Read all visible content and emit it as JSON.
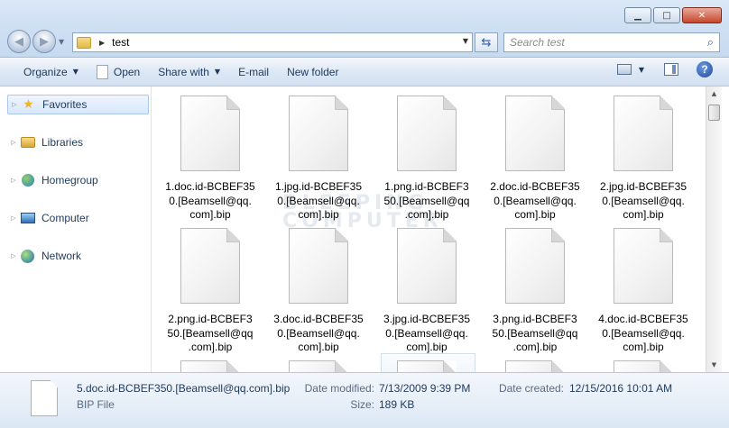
{
  "address": {
    "path": "test"
  },
  "search": {
    "placeholder": "Search test"
  },
  "toolbar": {
    "organize": "Organize",
    "open": "Open",
    "share_with": "Share with",
    "email": "E-mail",
    "new_folder": "New folder"
  },
  "sidebar": {
    "items": [
      {
        "label": "Favorites"
      },
      {
        "label": "Libraries"
      },
      {
        "label": "Homegroup"
      },
      {
        "label": "Computer"
      },
      {
        "label": "Network"
      }
    ]
  },
  "files": [
    {
      "name": "1.doc.id-BCBEF350.[Beamsell@qq.com].bip",
      "lines": [
        "1.doc.id-BCBEF35",
        "0.[Beamsell@qq.",
        "com].bip"
      ]
    },
    {
      "name": "1.jpg.id-BCBEF350.[Beamsell@qq.com].bip",
      "lines": [
        "1.jpg.id-BCBEF35",
        "0.[Beamsell@qq.",
        "com].bip"
      ]
    },
    {
      "name": "1.png.id-BCBEF350.[Beamsell@qq.com].bip",
      "lines": [
        "1.png.id-BCBEF3",
        "50.[Beamsell@qq",
        ".com].bip"
      ]
    },
    {
      "name": "2.doc.id-BCBEF350.[Beamsell@qq.com].bip",
      "lines": [
        "2.doc.id-BCBEF35",
        "0.[Beamsell@qq.",
        "com].bip"
      ]
    },
    {
      "name": "2.jpg.id-BCBEF350.[Beamsell@qq.com].bip",
      "lines": [
        "2.jpg.id-BCBEF35",
        "0.[Beamsell@qq.",
        "com].bip"
      ]
    },
    {
      "name": "2.png.id-BCBEF350.[Beamsell@qq.com].bip",
      "lines": [
        "2.png.id-BCBEF3",
        "50.[Beamsell@qq",
        ".com].bip"
      ]
    },
    {
      "name": "3.doc.id-BCBEF350.[Beamsell@qq.com].bip",
      "lines": [
        "3.doc.id-BCBEF35",
        "0.[Beamsell@qq.",
        "com].bip"
      ]
    },
    {
      "name": "3.jpg.id-BCBEF350.[Beamsell@qq.com].bip",
      "lines": [
        "3.jpg.id-BCBEF35",
        "0.[Beamsell@qq.",
        "com].bip"
      ]
    },
    {
      "name": "3.png.id-BCBEF350.[Beamsell@qq.com].bip",
      "lines": [
        "3.png.id-BCBEF3",
        "50.[Beamsell@qq",
        ".com].bip"
      ]
    },
    {
      "name": "4.doc.id-BCBEF350.[Beamsell@qq.com].bip",
      "lines": [
        "4.doc.id-BCBEF35",
        "0.[Beamsell@qq.",
        "com].bip"
      ]
    }
  ],
  "watermark": {
    "line1": "BLEEPING",
    "line2": "COMPUTER"
  },
  "details": {
    "name": "5.doc.id-BCBEF350.[Beamsell@qq.com].bip",
    "type": "BIP File",
    "modified_label": "Date modified:",
    "modified_value": "7/13/2009 9:39 PM",
    "size_label": "Size:",
    "size_value": "189 KB",
    "created_label": "Date created:",
    "created_value": "12/15/2016 10:01 AM"
  },
  "icons": {
    "back": "back-arrow-icon",
    "forward": "forward-arrow-icon",
    "folder": "folder-icon",
    "refresh": "refresh-icon",
    "search": "search-icon",
    "help": "help-icon"
  }
}
